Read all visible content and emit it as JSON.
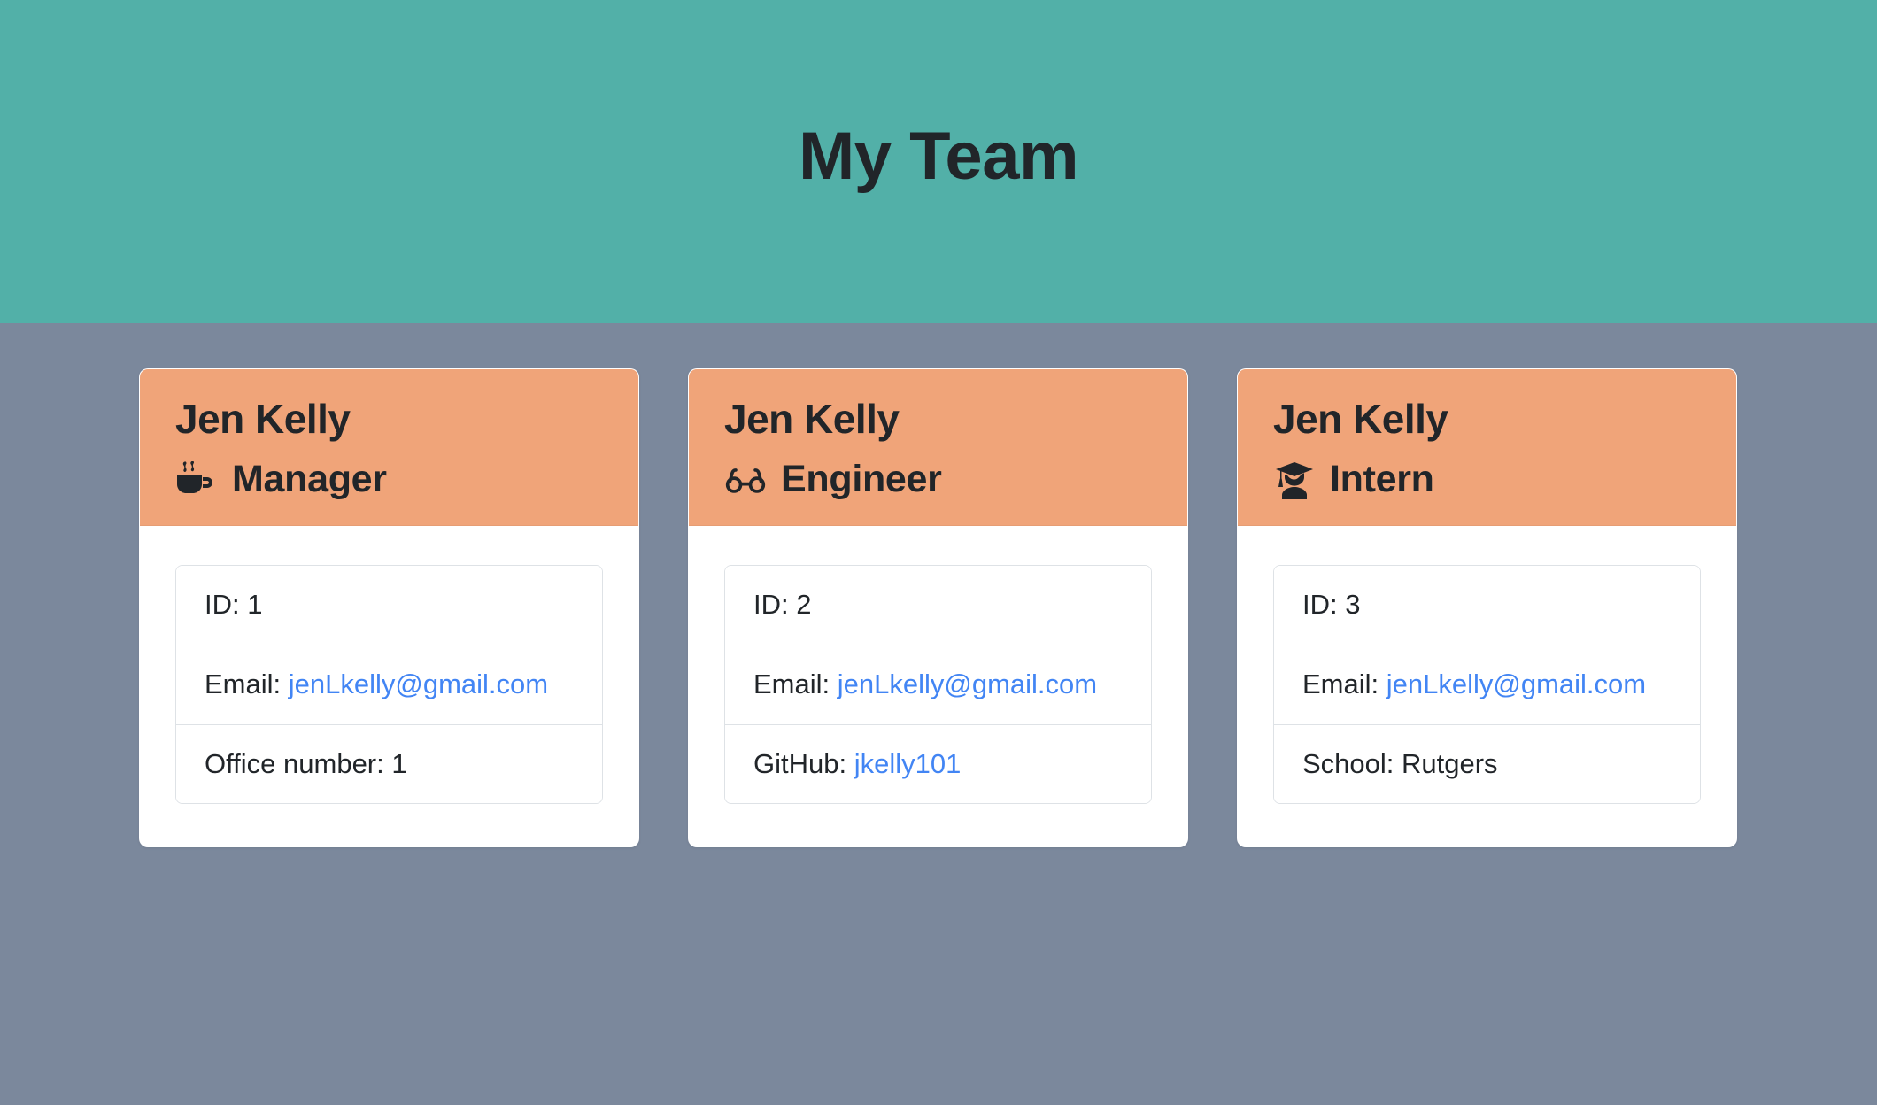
{
  "banner": {
    "title": "My Team",
    "background_color": "#52b0a8"
  },
  "page": {
    "background_color": "#7b889c"
  },
  "theme": {
    "card_header_color": "#f0a479",
    "card_body_color": "#ffffff",
    "link_color": "#4285f4",
    "text_color": "#212529",
    "divider_color": "#dee2e6"
  },
  "cards": [
    {
      "name": "Jen Kelly",
      "role": "Manager",
      "role_icon": "coffee-cup-icon",
      "items": [
        {
          "label": "ID: 1",
          "prefix": "ID: 1",
          "value": "",
          "is_link": false
        },
        {
          "label": "Email:",
          "prefix": "Email: ",
          "value": "jenLkelly@gmail.com",
          "is_link": true
        },
        {
          "label": "Office number:",
          "prefix": "Office number: ",
          "value": "1",
          "is_link": false
        }
      ]
    },
    {
      "name": "Jen Kelly",
      "role": "Engineer",
      "role_icon": "eyeglasses-icon",
      "items": [
        {
          "label": "ID: 2",
          "prefix": "ID: 2",
          "value": "",
          "is_link": false
        },
        {
          "label": "Email:",
          "prefix": "Email: ",
          "value": "jenLkelly@gmail.com",
          "is_link": true
        },
        {
          "label": "GitHub:",
          "prefix": "GitHub: ",
          "value": "jkelly101",
          "is_link": true
        }
      ]
    },
    {
      "name": "Jen Kelly",
      "role": "Intern",
      "role_icon": "graduate-student-icon",
      "items": [
        {
          "label": "ID: 3",
          "prefix": "ID: 3",
          "value": "",
          "is_link": false
        },
        {
          "label": "Email:",
          "prefix": "Email: ",
          "value": "jenLkelly@gmail.com",
          "is_link": true
        },
        {
          "label": "School:",
          "prefix": "School: ",
          "value": "Rutgers",
          "is_link": false
        }
      ]
    }
  ]
}
